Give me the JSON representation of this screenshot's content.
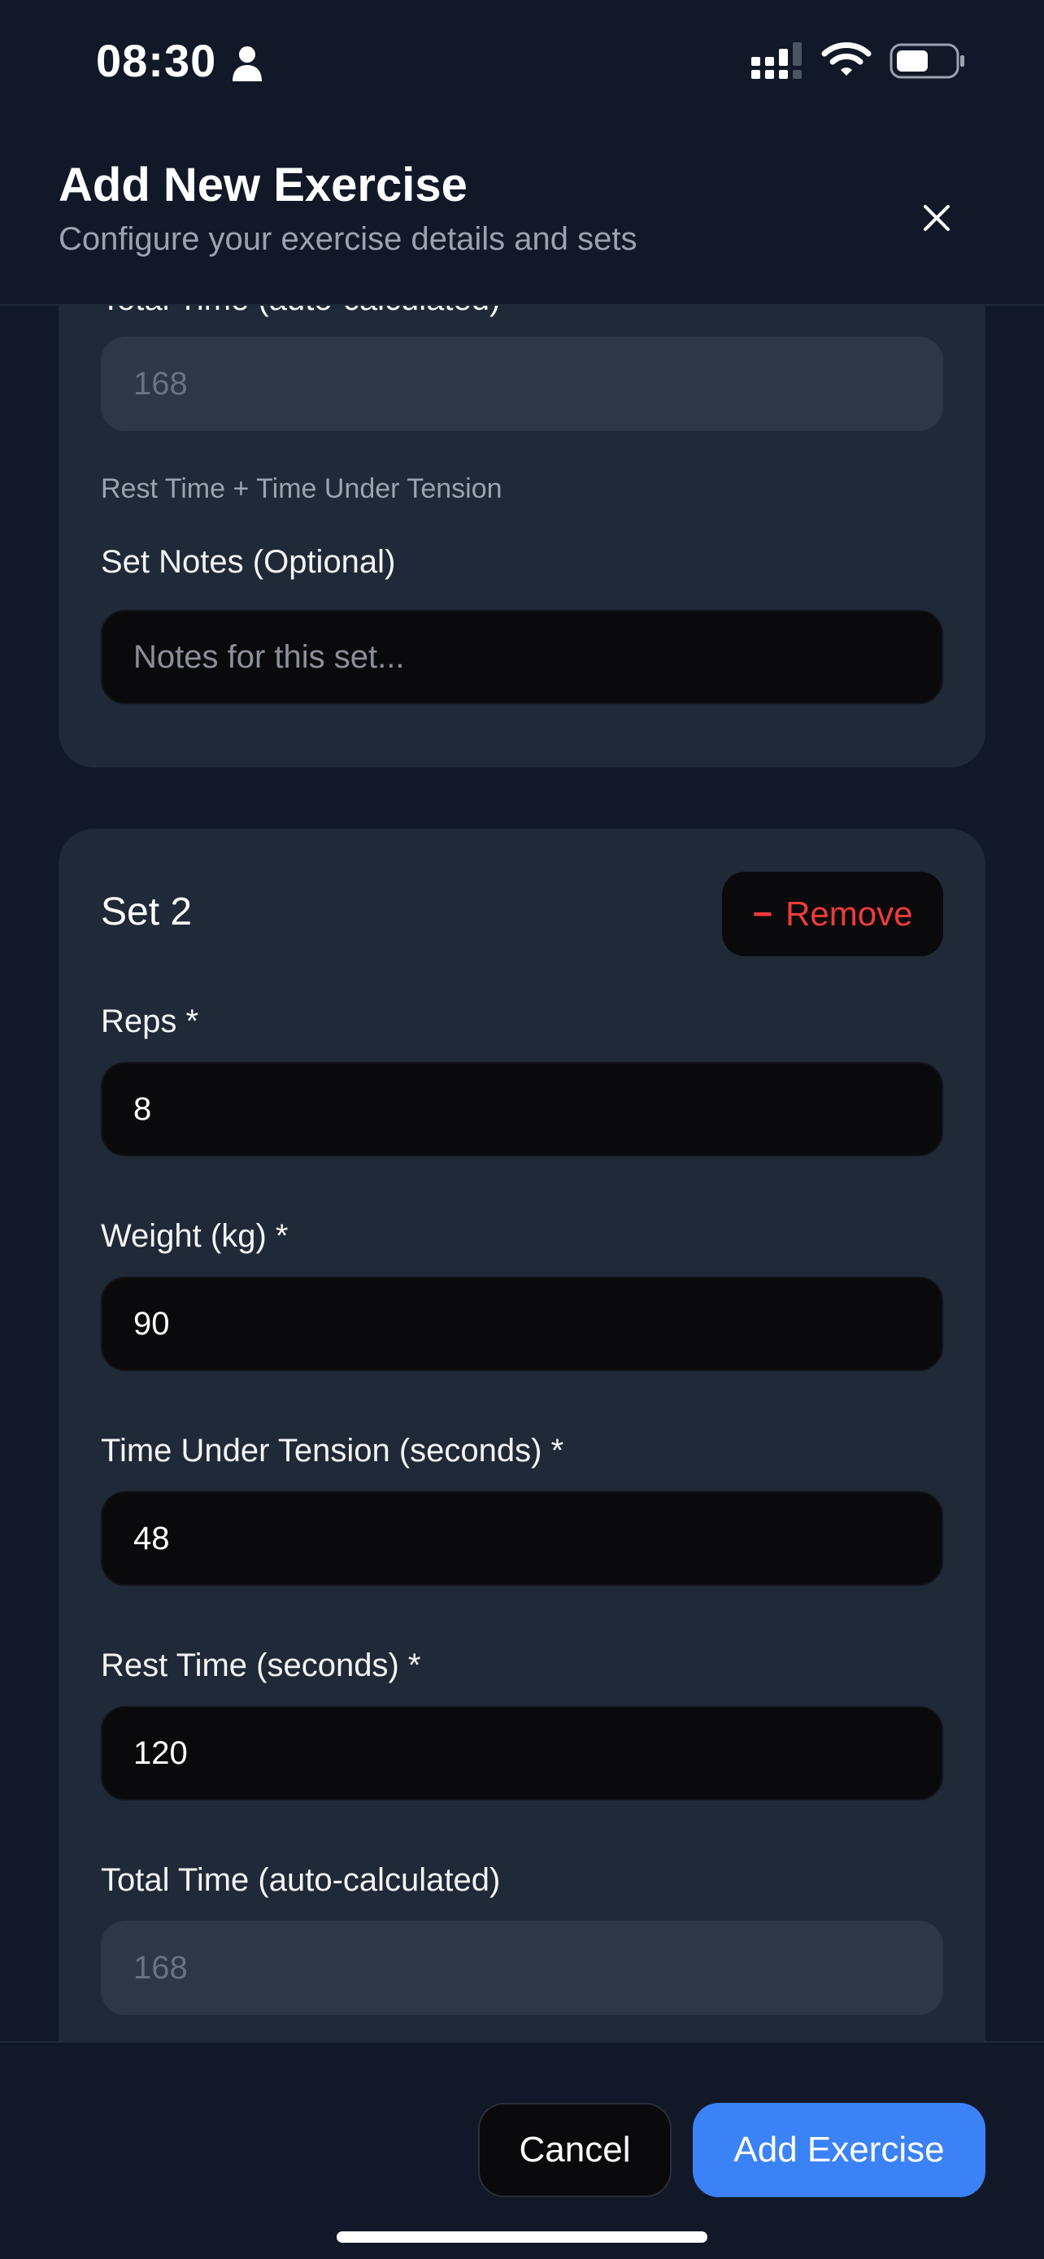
{
  "status_bar": {
    "time": "08:30",
    "icons": [
      "person-icon",
      "signal-icon",
      "wifi-icon",
      "battery-icon"
    ]
  },
  "modal": {
    "title": "Add New Exercise",
    "subtitle": "Configure your exercise details and sets",
    "close_icon": "close-icon"
  },
  "set1": {
    "total_time_label": "Total Time (auto-calculated)",
    "total_time_value": "168",
    "total_time_hint": "Rest Time + Time Under Tension",
    "notes_label": "Set Notes (Optional)",
    "notes_placeholder": "Notes for this set..."
  },
  "set2": {
    "title": "Set 2",
    "remove_label": "Remove",
    "remove_icon": "−",
    "reps_label": "Reps *",
    "reps_value": "8",
    "weight_label": "Weight (kg) *",
    "weight_value": "90",
    "tut_label": "Time Under Tension (seconds) *",
    "tut_value": "48",
    "rest_label": "Rest Time (seconds) *",
    "rest_value": "120",
    "total_time_label": "Total Time (auto-calculated)",
    "total_time_value": "168"
  },
  "footer": {
    "cancel_label": "Cancel",
    "add_label": "Add Exercise"
  },
  "colors": {
    "background": "#111827",
    "card": "#1f2937",
    "input": "#0a0a0c",
    "accent": "#3b82f6",
    "danger": "#ef3b3b"
  }
}
